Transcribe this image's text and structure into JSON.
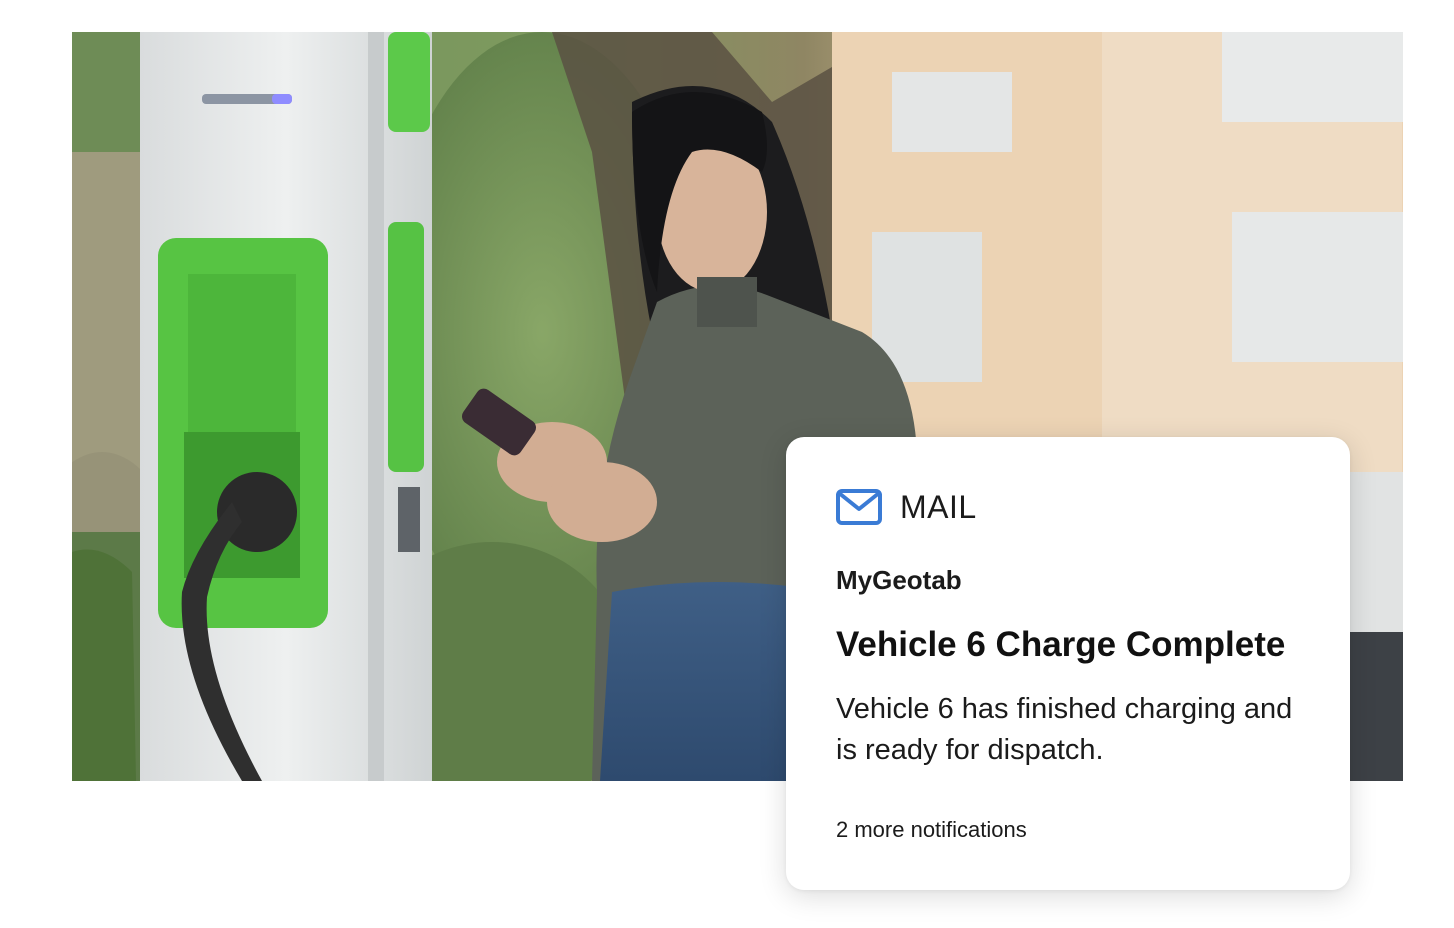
{
  "photo": {
    "subject": "woman using smartphone beside EV charging station"
  },
  "notification": {
    "app_icon": "mail-icon",
    "app_name": "MAIL",
    "sender": "MyGeotab",
    "title": "Vehicle 6 Charge Complete",
    "body": "Vehicle 6 has finished charging and is ready for dispatch.",
    "more": "2 more notifications",
    "accent_color": "#3a7bd5"
  }
}
